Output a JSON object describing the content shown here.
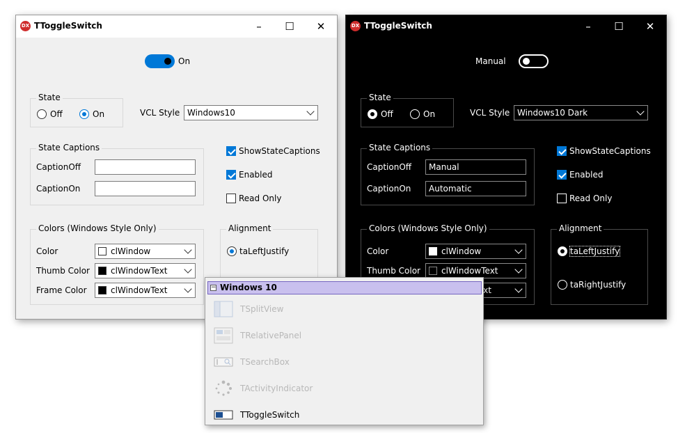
{
  "left_window": {
    "title": "TToggleSwitch",
    "toggle_label": "On",
    "state_group": {
      "title": "State",
      "off_label": "Off",
      "on_label": "On",
      "selected": "On"
    },
    "vcl_style": {
      "label": "VCL Style",
      "value": "Windows10"
    },
    "captions_group": {
      "title": "State Captions",
      "off_label": "CaptionOff",
      "off_value": "",
      "on_label": "CaptionOn",
      "on_value": ""
    },
    "checks": {
      "show_state_captions": "ShowStateCaptions",
      "enabled": "Enabled",
      "read_only": "Read Only"
    },
    "colors_group": {
      "title": "Colors (Windows Style Only)",
      "color_label": "Color",
      "color_value": "clWindow",
      "thumb_label": "Thumb Color",
      "thumb_value": "clWindowText",
      "frame_label": "Frame Color",
      "frame_value": "clWindowText"
    },
    "alignment_group": {
      "title": "Alignment",
      "left_label": "taLeftJustify"
    }
  },
  "right_window": {
    "title": "TToggleSwitch",
    "toggle_label": "Manual",
    "state_group": {
      "title": "State",
      "off_label": "Off",
      "on_label": "On",
      "selected": "Off"
    },
    "vcl_style": {
      "label": "VCL Style",
      "value": "Windows10 Dark"
    },
    "captions_group": {
      "title": "State Captions",
      "off_label": "CaptionOff",
      "off_value": "Manual",
      "on_label": "CaptionOn",
      "on_value": "Automatic"
    },
    "checks": {
      "show_state_captions": "ShowStateCaptions",
      "enabled": "Enabled",
      "read_only": "Read Only"
    },
    "colors_group": {
      "title": "Colors (Windows Style Only)",
      "color_label": "Color",
      "color_value": "clWindow",
      "thumb_label": "Thumb Color",
      "thumb_value": "clWindowText",
      "frame_value_partial": "ext"
    },
    "alignment_group": {
      "title": "Alignment",
      "left_label": "taLeftJustify",
      "right_label": "taRightJustify"
    }
  },
  "popup": {
    "header": "Windows 10",
    "items": [
      {
        "label": "TSplitView",
        "icon": "split-view-icon",
        "enabled": false
      },
      {
        "label": "TRelativePanel",
        "icon": "relative-panel-icon",
        "enabled": false
      },
      {
        "label": "TSearchBox",
        "icon": "search-box-icon",
        "enabled": false
      },
      {
        "label": "TActivityIndicator",
        "icon": "activity-indicator-icon",
        "enabled": false
      },
      {
        "label": "TToggleSwitch",
        "icon": "toggle-switch-icon",
        "enabled": true
      }
    ]
  },
  "colors": {
    "accent": "#0078d7",
    "popup_header": "#c9c0ee",
    "logo": "#cf2c2c"
  }
}
